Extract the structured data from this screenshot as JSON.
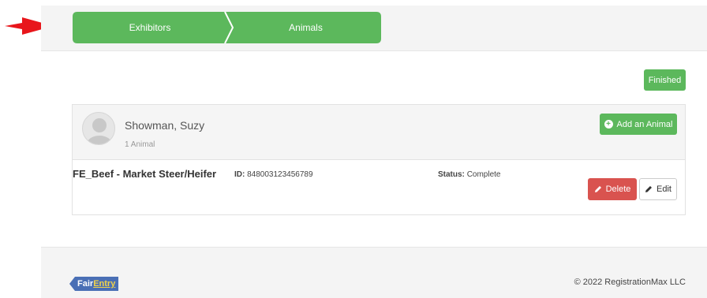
{
  "colors": {
    "step_green": "#5cb85c",
    "button_green": "#5cb85c",
    "delete_red": "#d9534f",
    "pointer_red": "#e8161b",
    "logo_blue": "#4a6fb5",
    "logo_yellow": "#f0d24a"
  },
  "steps": [
    {
      "label": "Exhibitors"
    },
    {
      "label": "Animals"
    }
  ],
  "finished_label": "Finished",
  "exhibitor": {
    "name": "Showman, Suzy",
    "animal_count": "1 Animal",
    "add_animal_label": "Add an Animal"
  },
  "animal": {
    "name": "FE_Beef - Market Steer/Heifer",
    "id_label": "ID:",
    "id_value": "848003123456789",
    "status_label": "Status:",
    "status_value": "Complete",
    "delete_label": "Delete",
    "edit_label": "Edit"
  },
  "footer": {
    "logo_part1": "Fair",
    "logo_part2": "Entry",
    "copyright": "© 2022 RegistrationMax LLC"
  },
  "icons": [
    "red-pointer-arrow-icon",
    "plus-circle-icon",
    "pencil-icon",
    "avatar-placeholder-icon"
  ]
}
